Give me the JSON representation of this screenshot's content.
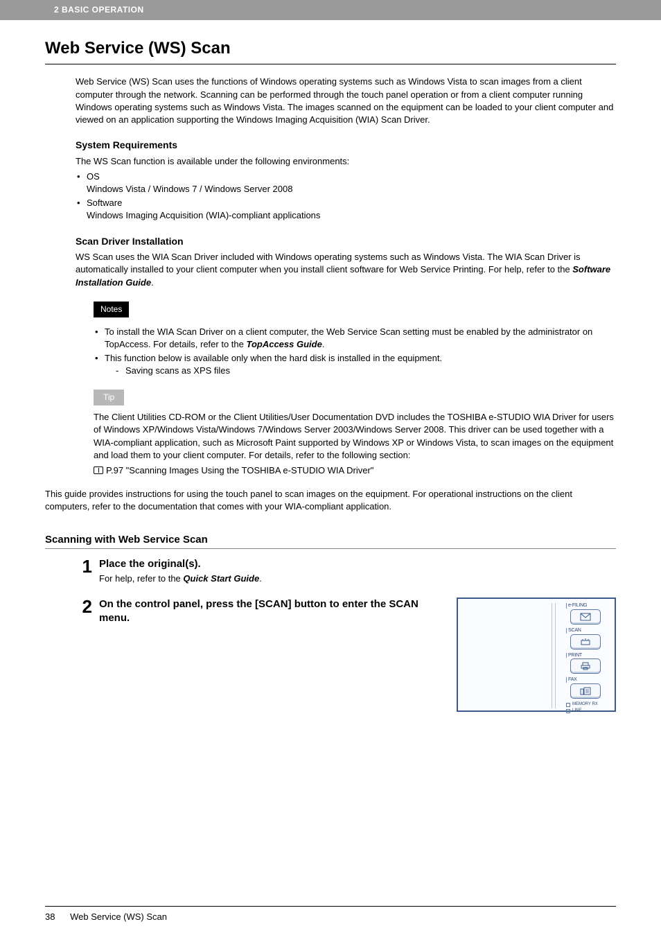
{
  "header": {
    "chapter": "2 BASIC OPERATION"
  },
  "title": "Web Service (WS) Scan",
  "intro": "Web Service (WS) Scan uses the functions of Windows operating systems such as Windows Vista to scan images from a client computer through the network. Scanning can be performed through the touch panel operation or from a client computer running Windows operating systems such as Windows Vista. The images scanned on the equipment can be loaded to your client computer and viewed on an application supporting the Windows Imaging Acquisition (WIA) Scan Driver.",
  "sysreq": {
    "heading": "System Requirements",
    "lead": "The WS Scan function is available under the following environments:",
    "os_label": "OS",
    "os_value": "Windows Vista / Windows 7 / Windows Server 2008",
    "sw_label": "Software",
    "sw_value": "Windows Imaging Acquisition (WIA)-compliant applications"
  },
  "driver": {
    "heading": "Scan Driver Installation",
    "body_pre": "WS Scan uses the WIA Scan Driver included with Windows operating systems such as Windows Vista. The WIA Scan Driver is automatically installed to your client computer when you install client software for Web Service Printing. For help, refer to the ",
    "body_em": "Software Installation Guide",
    "body_post": "."
  },
  "notes": {
    "label": "Notes",
    "item1_pre": "To install the WIA Scan Driver on a client computer, the Web Service Scan setting must be enabled by the administrator on TopAccess. For details, refer to the ",
    "item1_em": "TopAccess Guide",
    "item1_post": ".",
    "item2": "This function below is available only when the hard disk is installed in the equipment.",
    "item2_sub": "Saving scans as XPS files"
  },
  "tip": {
    "label": "Tip",
    "body": "The Client Utilities CD-ROM or the Client Utilities/User Documentation DVD includes the TOSHIBA e-STUDIO WIA Driver for users of Windows XP/Windows Vista/Windows 7/Windows Server 2003/Windows Server 2008. This driver can be used together with a WIA-compliant application, such as Microsoft Paint supported by Windows XP or Windows Vista, to scan images on the equipment and load them to your client computer. For details, refer to the following section:",
    "ref": "P.97 \"Scanning Images Using the TOSHIBA e-STUDIO WIA Driver\""
  },
  "guide_note": "This guide provides instructions for using the touch panel to scan images on the equipment. For operational instructions on the client computers, refer to the documentation that comes with your WIA-compliant application.",
  "subsection": "Scanning with Web Service Scan",
  "steps": {
    "s1": {
      "num": "1",
      "title": "Place the original(s).",
      "text_pre": "For help, refer to the ",
      "text_em": "Quick Start Guide",
      "text_post": "."
    },
    "s2": {
      "num": "2",
      "title": "On the control panel, press the [SCAN] button to enter the SCAN menu."
    }
  },
  "panel": {
    "btn1": "e-FILING",
    "btn2": "SCAN",
    "btn3": "PRINT",
    "btn4": "FAX",
    "ind1": "MEMORY RX",
    "ind2": "LINE"
  },
  "footer": {
    "page": "38",
    "title": "Web Service (WS) Scan"
  }
}
